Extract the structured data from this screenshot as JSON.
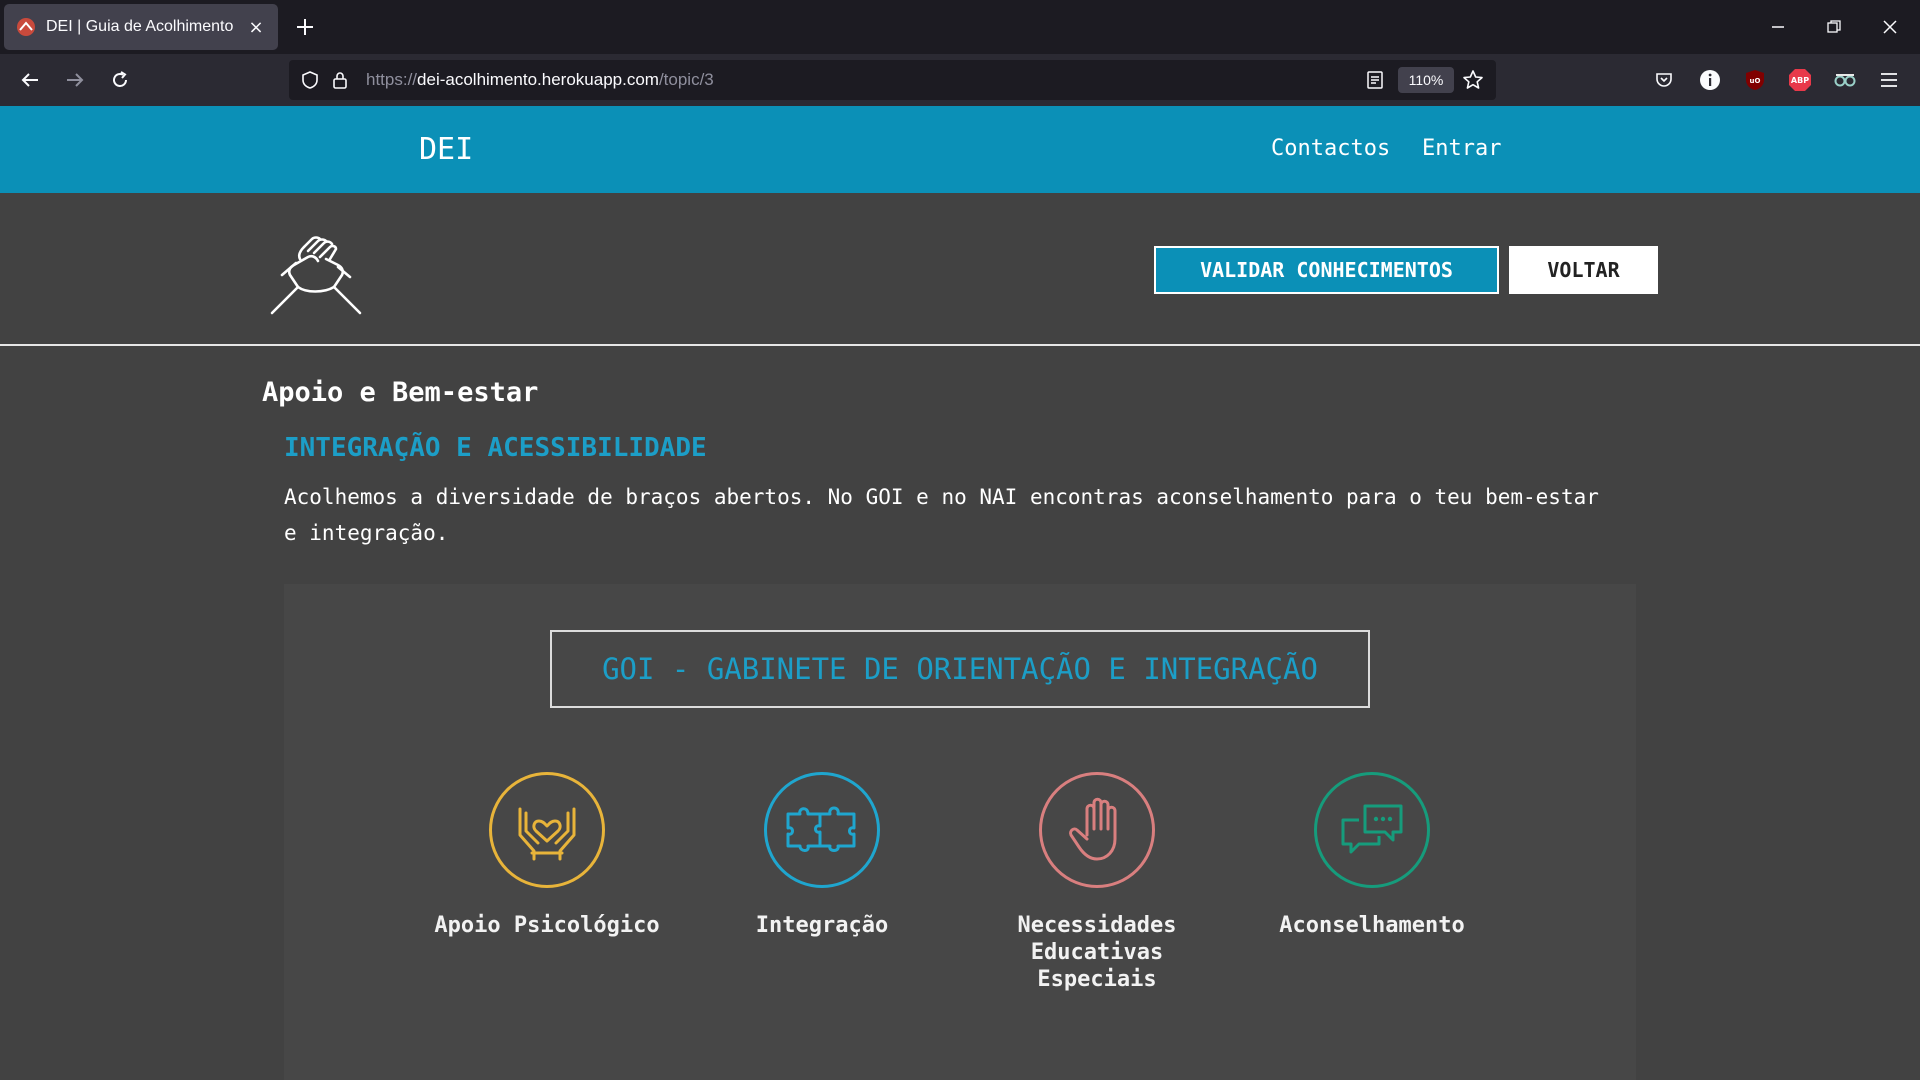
{
  "browser": {
    "tab_title": "DEI | Guia de Acolhimento",
    "url_prefix": "https://",
    "url_host": "dei-acolhimento.herokuapp.com",
    "url_path": "/topic/3",
    "zoom": "110%",
    "extension_abp": "ABP"
  },
  "header": {
    "brand": "DEI",
    "nav": [
      "Contactos",
      "Entrar"
    ]
  },
  "topic": {
    "validate_label": "VALIDAR CONHECIMENTOS",
    "back_label": "VOLTAR"
  },
  "content": {
    "section_title": "Apoio e Bem-estar",
    "subtitle": "INTEGRAÇÃO E ACESSIBILIDADE",
    "description": "Acolhemos a diversidade de braços abertos. No GOI e no NAI encontras aconselhamento para o teu bem-estar e integração.",
    "card_title": "GOI - GABINETE DE ORIENTAÇÃO E INTEGRAÇÃO",
    "features": [
      {
        "label": "Apoio Psicológico",
        "icon": "hands-heart-icon",
        "color": "#e8b43a"
      },
      {
        "label": "Integração",
        "icon": "puzzle-icon",
        "color": "#1fa6cf"
      },
      {
        "label": "Necessidades Educativas Especiais",
        "icon": "hand-icon",
        "color": "#d97f7f"
      },
      {
        "label": "Aconselhamento",
        "icon": "chat-bubbles-icon",
        "color": "#169c7c"
      }
    ]
  },
  "colors": {
    "brand_blue": "#0b90b7",
    "page_bg": "#424242",
    "accent_text": "#1c9ec7"
  }
}
